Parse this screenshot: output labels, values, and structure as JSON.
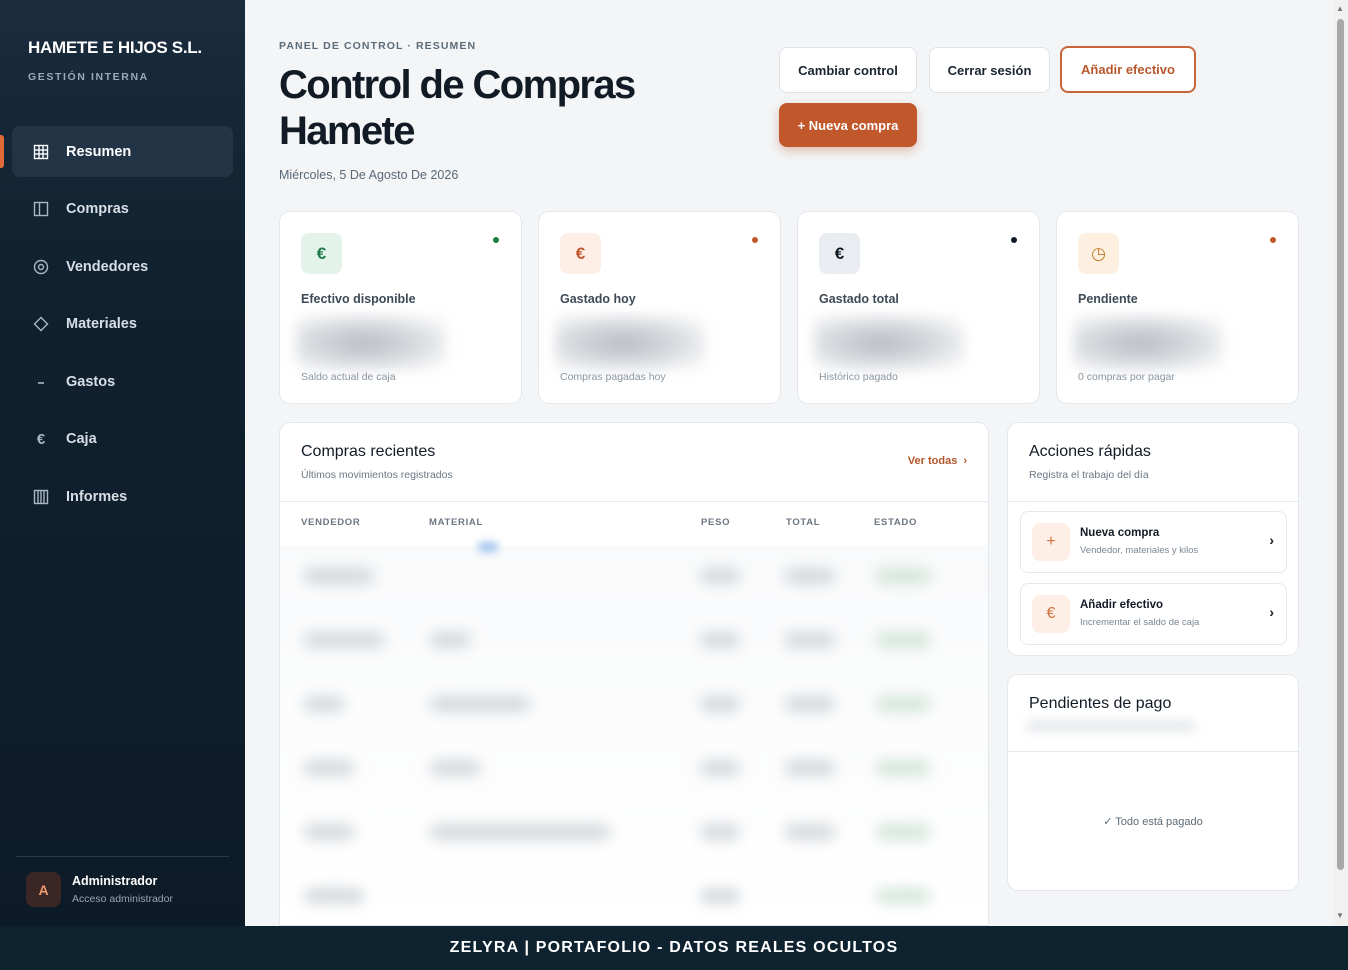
{
  "sidebar": {
    "brand_name": "HAMETE E HIJOS S.L.",
    "brand_sub": "GESTIÓN INTERNA",
    "items": [
      {
        "label": "Resumen",
        "icon": "grid-icon",
        "active": true
      },
      {
        "label": "Compras",
        "icon": "columns-icon"
      },
      {
        "label": "Vendedores",
        "icon": "target-icon"
      },
      {
        "label": "Materiales",
        "icon": "diamond-icon"
      },
      {
        "label": "Gastos",
        "icon": "minus-icon"
      },
      {
        "label": "Caja",
        "icon": "euro-icon"
      },
      {
        "label": "Informes",
        "icon": "bars-icon"
      }
    ],
    "user": {
      "initial": "A",
      "name": "Administrador",
      "role": "Acceso administrador"
    }
  },
  "header": {
    "eyebrow": "PANEL DE CONTROL · RESUMEN",
    "title": "Control de Compras Hamete",
    "date": "Miércoles, 5 De Agosto De 2026",
    "buttons": {
      "change": "Cambiar control",
      "logout": "Cerrar sesión",
      "add_cash": "Añadir efectivo",
      "new_purchase": "+ Nueva compra"
    }
  },
  "stats": [
    {
      "label": "Efectivo disponible",
      "sub": "Saldo actual de caja",
      "icon": "€",
      "icon_bg": "#e4f3ea",
      "icon_color": "#1f7a4a",
      "dot": "#1f7a4a"
    },
    {
      "label": "Gastado hoy",
      "sub": "Compras pagadas hoy",
      "icon": "€",
      "icon_bg": "#fdeee6",
      "icon_color": "#c0582c",
      "dot": "#c0582c"
    },
    {
      "label": "Gastado total",
      "sub": "Histórico pagado",
      "icon": "€",
      "icon_bg": "#e9edf1",
      "icon_color": "#121b25",
      "dot": "#121b25"
    },
    {
      "label": "Pendiente",
      "sub": "0 compras por pagar",
      "icon": "◷",
      "icon_bg": "#fdf0e1",
      "icon_color": "#c27a22",
      "dot": "#c0582c"
    }
  ],
  "recent": {
    "title": "Compras recientes",
    "sub": "Últimos movimientos registrados",
    "see_all": "Ver todas",
    "columns": [
      "VENDEDOR",
      "MATERIAL",
      "PESO",
      "TOTAL",
      "ESTADO"
    ]
  },
  "quick": {
    "title": "Acciones rápidas",
    "sub": "Registra el trabajo del día",
    "actions": [
      {
        "icon": "+",
        "title": "Nueva compra",
        "sub": "Vendedor, materiales y kilos"
      },
      {
        "icon": "€",
        "title": "Añadir efectivo",
        "sub": "Incrementar el saldo de caja"
      }
    ]
  },
  "pending": {
    "title": "Pendientes de pago",
    "note": "✓ Todo está pagado"
  },
  "banner": "ZELYRA | PORTAFOLIO - DATOS REALES OCULTOS"
}
